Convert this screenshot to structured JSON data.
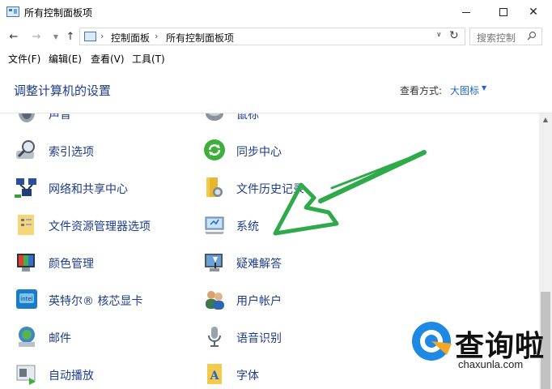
{
  "window": {
    "title": "所有控制面板项"
  },
  "address": {
    "crumbs": [
      "控制面板",
      "所有控制面板项"
    ],
    "search_placeholder": "搜索控制"
  },
  "menu": [
    "文件(F)",
    "编辑(E)",
    "查看(V)",
    "工具(T)"
  ],
  "header": {
    "title": "调整计算机的设置",
    "view_label": "查看方式:",
    "view_value": "大图标"
  },
  "items": [
    {
      "label": "声音",
      "icon": "speaker-icon"
    },
    {
      "label": "鼠标",
      "icon": "mouse-icon"
    },
    {
      "label": "索引选项",
      "icon": "magnifier-icon"
    },
    {
      "label": "同步中心",
      "icon": "sync-icon"
    },
    {
      "label": "网络和共享中心",
      "icon": "network-icon"
    },
    {
      "label": "文件历史记录",
      "icon": "file-history-icon"
    },
    {
      "label": "文件资源管理器选项",
      "icon": "folder-options-icon"
    },
    {
      "label": "系统",
      "icon": "computer-icon"
    },
    {
      "label": "颜色管理",
      "icon": "color-management-icon"
    },
    {
      "label": "疑难解答",
      "icon": "troubleshooting-icon"
    },
    {
      "label": "英特尔® 核芯显卡",
      "icon": "intel-graphics-icon"
    },
    {
      "label": "用户帐户",
      "icon": "user-accounts-icon"
    },
    {
      "label": "邮件",
      "icon": "mail-icon"
    },
    {
      "label": "语音识别",
      "icon": "microphone-icon"
    },
    {
      "label": "自动播放",
      "icon": "autoplay-icon"
    },
    {
      "label": "字体",
      "icon": "fonts-icon"
    }
  ],
  "watermark": {
    "cn": "查询啦",
    "en": "chaxunla.com"
  },
  "colors": {
    "link": "#1e3c8c",
    "accent_blue": "#1a66c9",
    "arrow_green": "#2eaa4a"
  }
}
